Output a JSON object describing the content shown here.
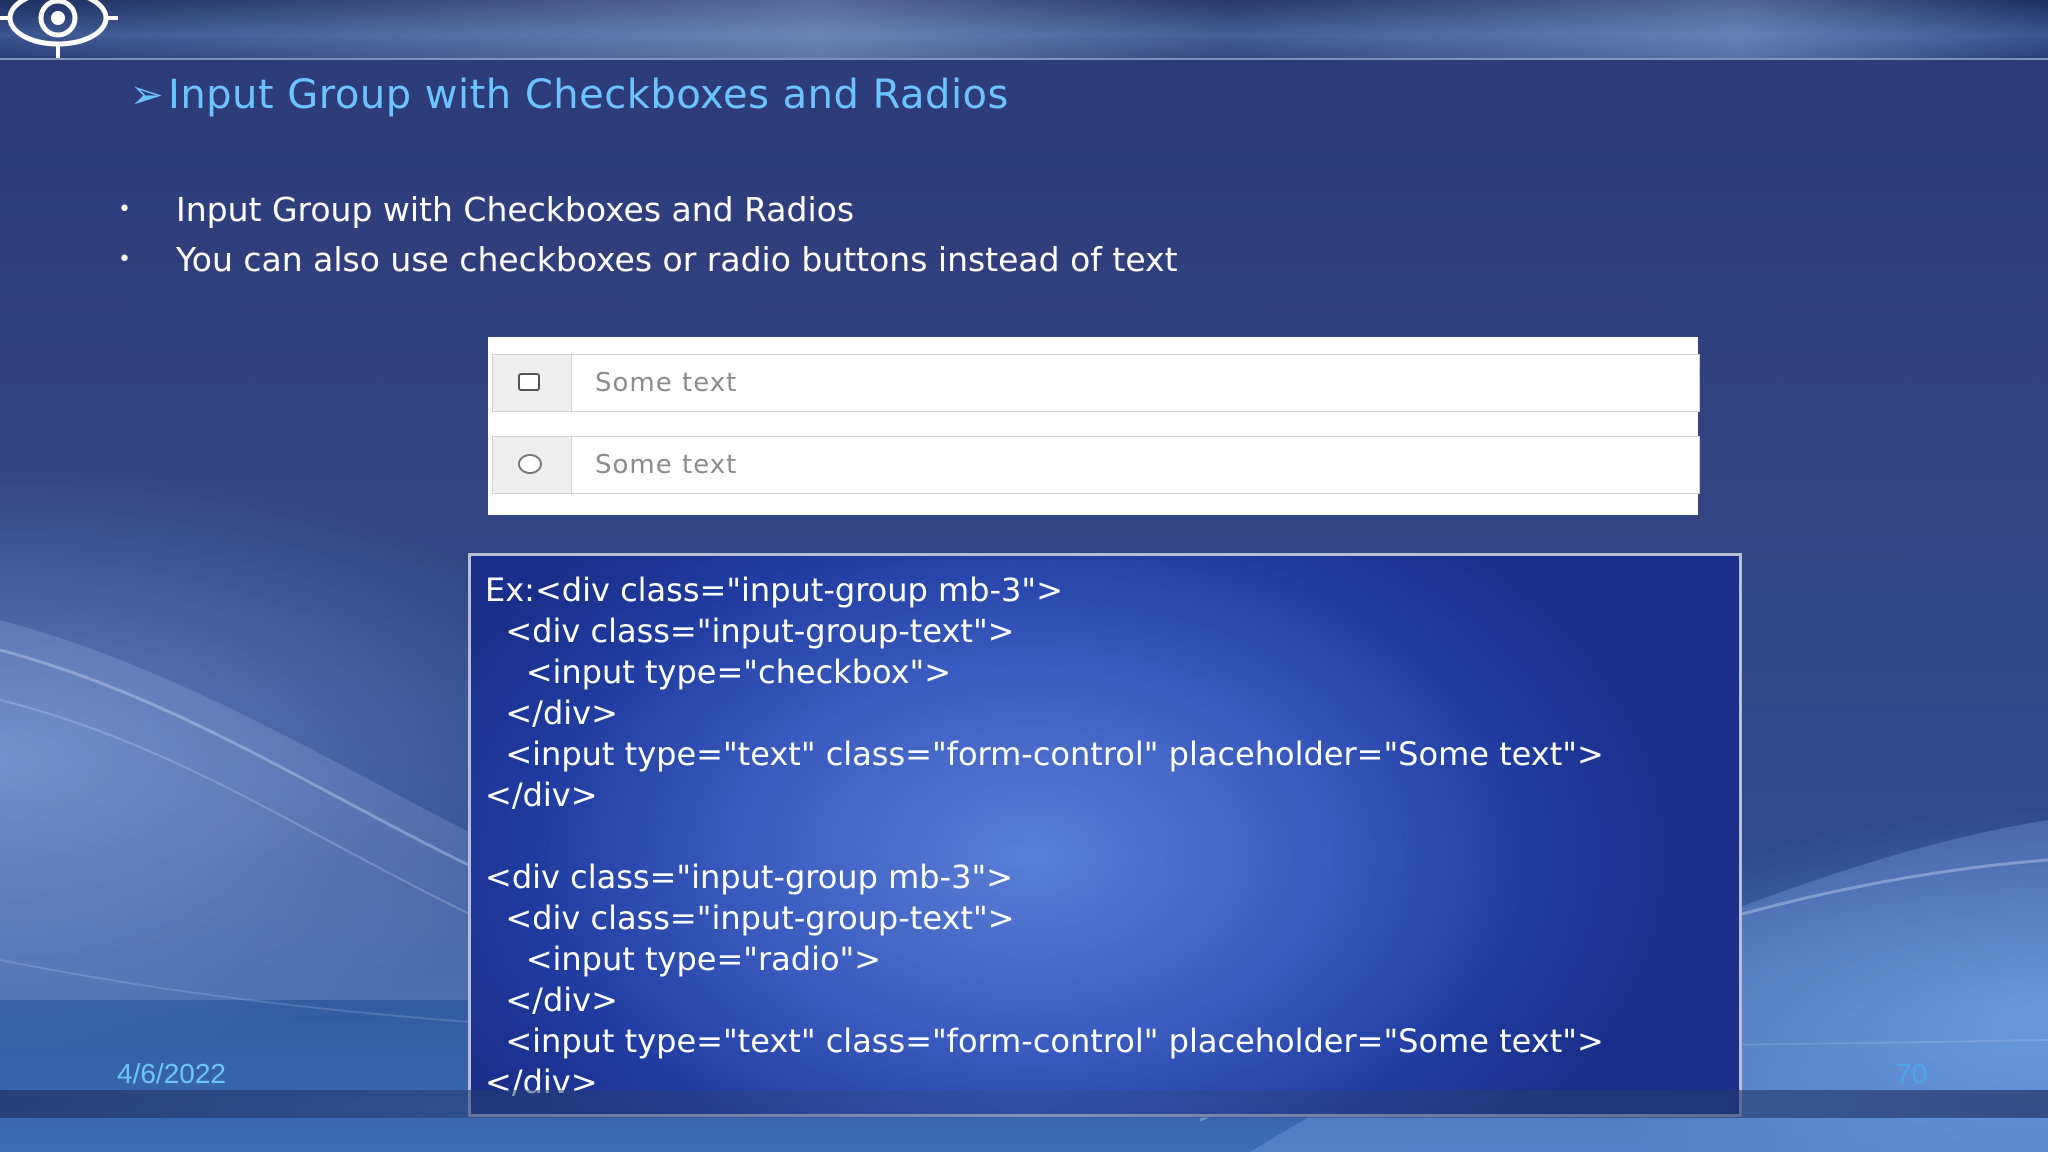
{
  "slide": {
    "title_arrow": "➢",
    "title": "Input Group with Checkboxes and Radios",
    "bullets": [
      "Input Group with Checkboxes and Radios",
      "You can also use checkboxes or radio buttons instead of text"
    ],
    "bullet_symbol": "•",
    "demo": {
      "row1_placeholder": "Some text",
      "row2_placeholder": "Some text"
    },
    "code": "Ex:<div class=\"input-group mb-3\">\n  <div class=\"input-group-text\">\n    <input type=\"checkbox\">\n  </div>\n  <input type=\"text\" class=\"form-control\" placeholder=\"Some text\">\n</div>\n\n<div class=\"input-group mb-3\">\n  <div class=\"input-group-text\">\n    <input type=\"radio\">\n  </div>\n  <input type=\"text\" class=\"form-control\" placeholder=\"Some text\">\n</div>",
    "date": "4/6/2022",
    "page_number": "70"
  },
  "colors": {
    "title": "#6cc4ff",
    "body_text": "#ffffff",
    "code_bg": "#3a5bbf"
  }
}
